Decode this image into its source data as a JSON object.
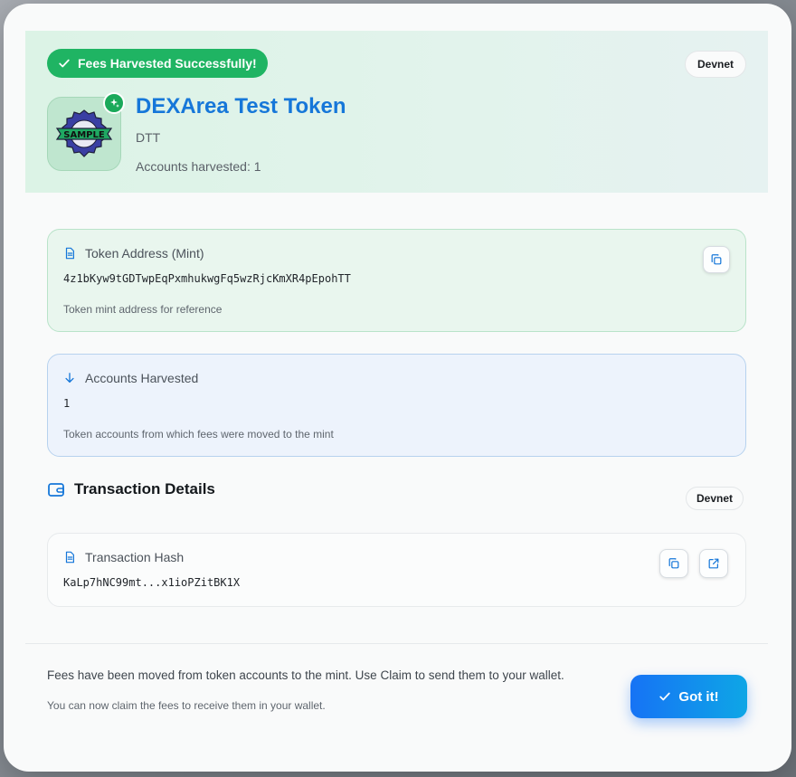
{
  "header": {
    "success_badge": "Fees Harvested Successfully!",
    "network": "Devnet",
    "token_name": "DEXArea Test Token",
    "token_symbol": "DTT",
    "accounts_harvested_text": "Accounts harvested: 1",
    "logo_text": "SAMPLE"
  },
  "mint_card": {
    "label": "Token Address (Mint)",
    "value": "4z1bKyw9tGDTwpEqPxmhukwgFq5wzRjcKmXR4pEpohTT",
    "note": "Token mint address for reference"
  },
  "accounts_card": {
    "label": "Accounts Harvested",
    "value": "1",
    "note": "Token accounts from which fees were moved to the mint"
  },
  "transaction": {
    "section_title": "Transaction Details",
    "network": "Devnet",
    "hash_label": "Transaction Hash",
    "hash_value": "KaLp7hNC99mt...x1ioPZitBK1X"
  },
  "footer": {
    "message": "Fees have been moved from token accounts to the mint. Use Claim to send them to your wallet.",
    "sub_message": "You can now claim the fees to receive them in your wallet.",
    "button_label": "Got it!"
  },
  "colors": {
    "success": "#1fb463",
    "accent": "#1677d9",
    "button_gradient_start": "#1673f5",
    "button_gradient_end": "#0ea6e6"
  },
  "icons": {
    "success_badge": "check-icon",
    "logo_badge": "sparkle-icon",
    "mint_label": "document-icon",
    "accounts_label": "arrow-down-icon",
    "section": "wallet-icon",
    "copy": "copy-icon",
    "external": "external-link-icon",
    "button": "check-icon"
  }
}
